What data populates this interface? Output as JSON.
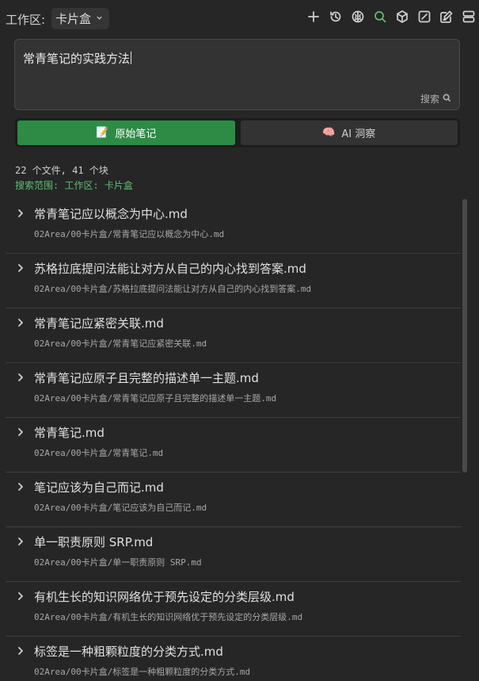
{
  "workspace": {
    "label": "工作区:",
    "selected": "卡片盒"
  },
  "toolbar": {
    "icons": [
      "plus-icon",
      "history-icon",
      "brain-icon",
      "search-icon",
      "cube-icon",
      "edit-icon",
      "edit-note-icon",
      "layout-icon"
    ],
    "active_color": "#5fbf73"
  },
  "search": {
    "query": "常青笔记的实践方法",
    "button_label": "搜索"
  },
  "tabs": [
    {
      "emoji": "📝",
      "label": "原始笔记",
      "active": true
    },
    {
      "emoji": "🧠",
      "label": "AI 洞察",
      "active": false
    }
  ],
  "summary": {
    "stats": "22 个文件, 41 个块",
    "scope": "搜索范围: 工作区: 卡片盒"
  },
  "results": [
    {
      "title": "常青笔记应以概念为中心.md",
      "path": "02Area/00卡片盒/常青笔记应以概念为中心.md"
    },
    {
      "title": "苏格拉底提问法能让对方从自己的内心找到答案.md",
      "path": "02Area/00卡片盒/苏格拉底提问法能让对方从自己的内心找到答案.md"
    },
    {
      "title": "常青笔记应紧密关联.md",
      "path": "02Area/00卡片盒/常青笔记应紧密关联.md"
    },
    {
      "title": "常青笔记应原子且完整的描述单一主题.md",
      "path": "02Area/00卡片盒/常青笔记应原子且完整的描述单一主题.md"
    },
    {
      "title": "常青笔记.md",
      "path": "02Area/00卡片盒/常青笔记.md"
    },
    {
      "title": "笔记应该为自己而记.md",
      "path": "02Area/00卡片盒/笔记应该为自己而记.md"
    },
    {
      "title": "单一职责原则 SRP.md",
      "path": "02Area/00卡片盒/单一职责原则 SRP.md"
    },
    {
      "title": "有机生长的知识网络优于预先设定的分类层级.md",
      "path": "02Area/00卡片盒/有机生长的知识网络优于预先设定的分类层级.md"
    },
    {
      "title": "标签是一种粗颗粒度的分类方式.md",
      "path": "02Area/00卡片盒/标签是一种粗颗粒度的分类方式.md"
    }
  ],
  "colors": {
    "background": "#262626",
    "accent_green": "#2e8b45",
    "scope_text": "#5fbf73"
  }
}
